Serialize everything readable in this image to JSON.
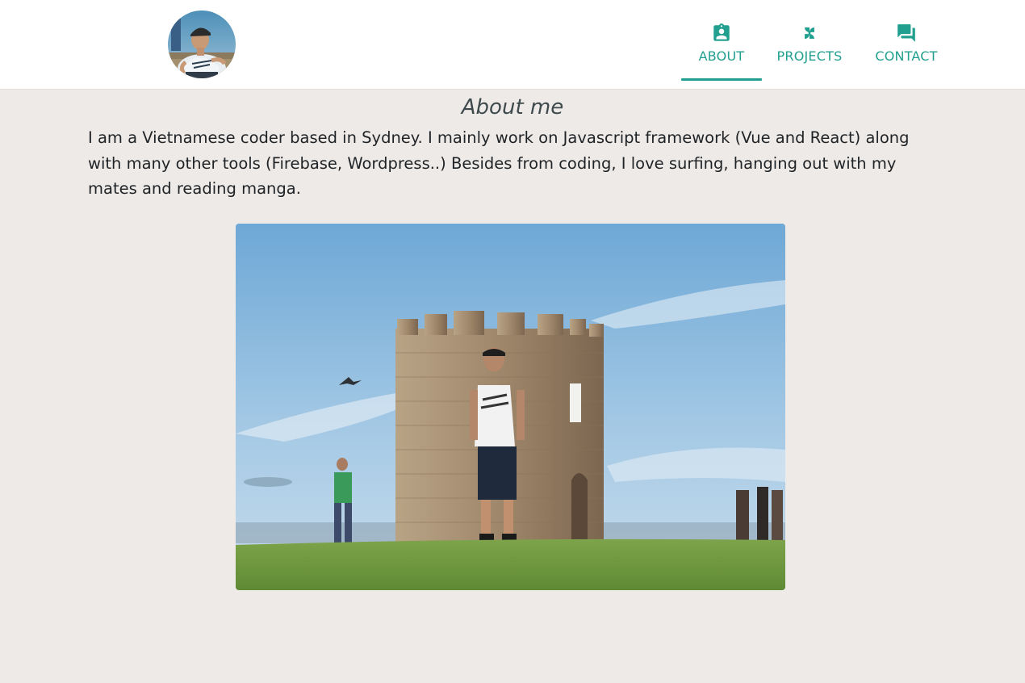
{
  "header": {
    "avatar_icon": "profile-avatar",
    "nav": [
      {
        "label": "ABOUT",
        "icon": "contact-badge-icon",
        "active": true
      },
      {
        "label": "PROJECTS",
        "icon": "pinwheel-icon",
        "active": false
      },
      {
        "label": "CONTACT",
        "icon": "chat-bubbles-icon",
        "active": false
      }
    ]
  },
  "main": {
    "title": "About me",
    "bio": "I am a Vietnamese coder based in Sydney. I mainly work on Javascript framework (Vue and React) along with many other tools (Firebase, Wordpress..) Besides from coding, I love surfing, hanging out with my mates and reading manga."
  },
  "colors": {
    "accent": "#22a08f",
    "background": "#eeeae8",
    "header": "#ffffff",
    "text": "#1f2326"
  }
}
